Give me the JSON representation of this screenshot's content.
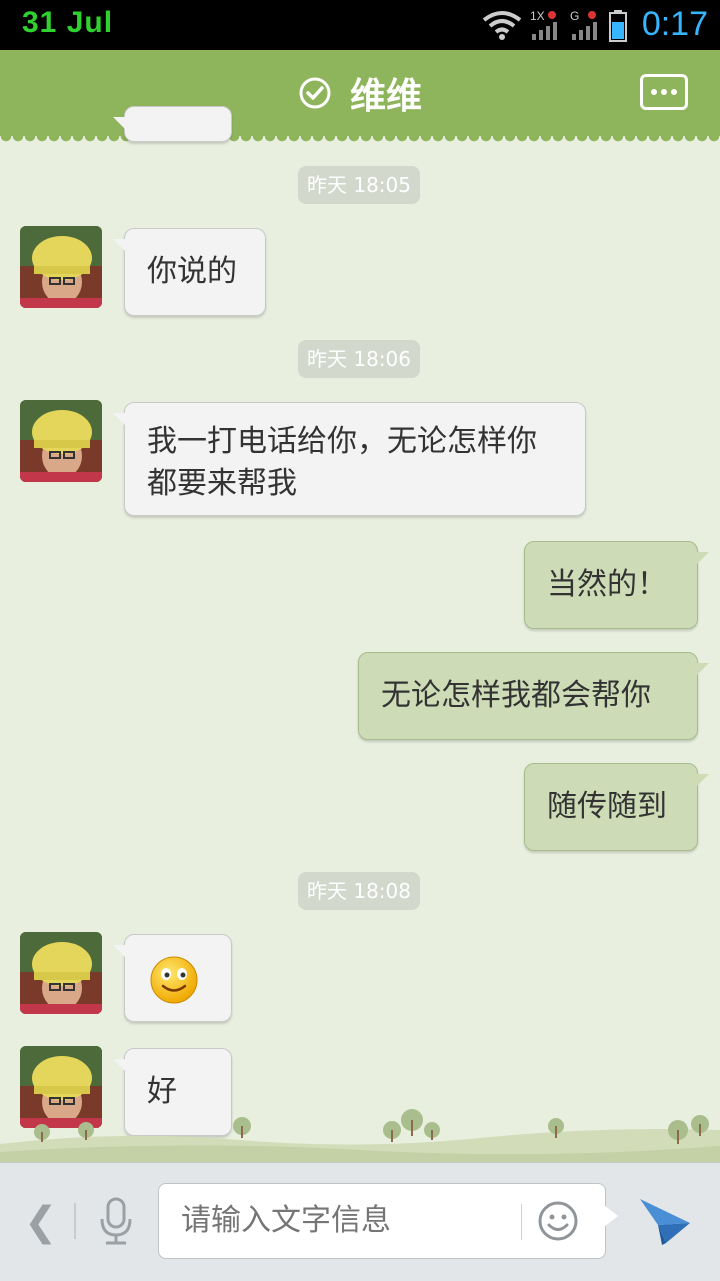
{
  "status_bar": {
    "date": "31 Jul",
    "time": "0:17",
    "time_color": "#37b6ff",
    "date_color": "#2fd12f",
    "icons": [
      "wifi-icon",
      "signal-1x-icon",
      "signal-g-icon",
      "battery-icon"
    ]
  },
  "header": {
    "title": "维维",
    "verified_icon": "check-circle-icon",
    "more_icon": "more-dots-icon",
    "background": "#8fb55c"
  },
  "messages": {
    "t1": "昨天 18:05",
    "m1": "你说的",
    "t2": "昨天 18:06",
    "m2": "我一打电话给你，无论怎样你都要来帮我",
    "m3": "当然的！",
    "m4": "无论怎样我都会帮你",
    "m5": "随传随到",
    "t3": "昨天 18:08",
    "m6_icon": "smiley-emoji-icon",
    "m7": "好"
  },
  "input_bar": {
    "placeholder": "请输入文字信息",
    "left_icon": "chevron-left-icon",
    "voice_icon": "microphone-icon",
    "emoji_icon": "smiley-face-icon",
    "send_icon": "paper-plane-icon"
  },
  "colors": {
    "chat_background": "#e8efdf",
    "incoming_bubble": "#f3f3f3",
    "outgoing_bubble": "#cddcb6"
  }
}
